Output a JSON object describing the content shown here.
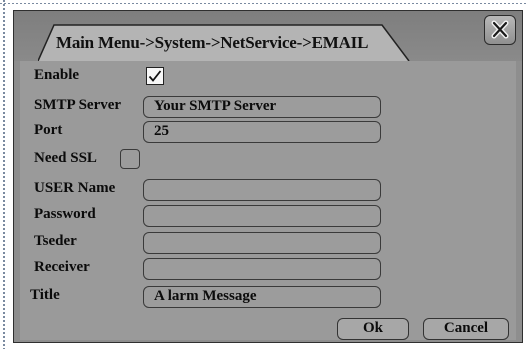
{
  "window": {
    "breadcrumb": "Main Menu->System->NetService->EMAIL"
  },
  "form": {
    "enable": {
      "label": "Enable",
      "checked": true
    },
    "smtp_server": {
      "label": "SMTP Server",
      "value": "Your SMTP Server"
    },
    "port": {
      "label": "Port",
      "value": "25"
    },
    "need_ssl": {
      "label": "Need SSL",
      "checked": false
    },
    "user_name": {
      "label": "USER Name",
      "value": ""
    },
    "password": {
      "label": "Password",
      "value": ""
    },
    "sender": {
      "label": "Tseder",
      "value": ""
    },
    "receiver": {
      "label": "Receiver",
      "value": ""
    },
    "title": {
      "label": "Title",
      "value": "A larm Message"
    }
  },
  "buttons": {
    "ok": "Ok",
    "cancel": "Cancel"
  },
  "icons": {
    "close": "close-x-icon",
    "check": "checkmark-icon"
  }
}
